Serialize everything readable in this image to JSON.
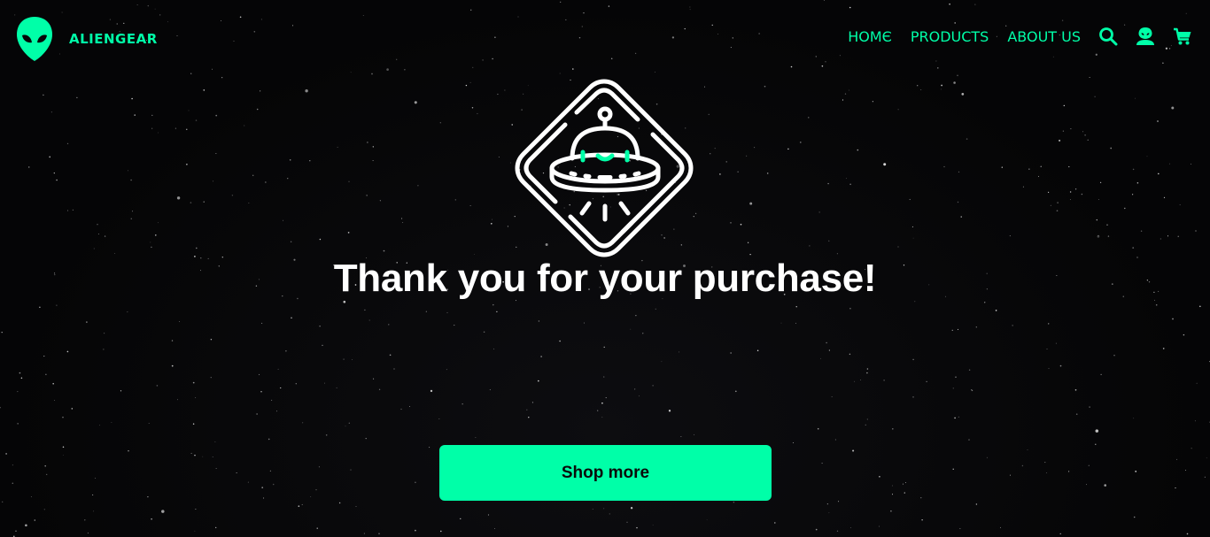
{
  "colors": {
    "accent": "#00ffa8",
    "background": "#070708",
    "text": "#ffffff",
    "button_text": "#0a0a0a"
  },
  "header": {
    "brand": "ALIENGEAR",
    "logo_icon": "alien-head-icon",
    "nav": [
      {
        "label": "HOMЄ"
      },
      {
        "label": "PRODUCTS"
      },
      {
        "label": "ABOUT US"
      }
    ],
    "icons": [
      "search-icon",
      "account-icon",
      "cart-icon"
    ]
  },
  "main": {
    "badge_icon": "ufo-badge-icon",
    "headline": "Thank you for your purchase!",
    "cta_label": "Shop more"
  }
}
